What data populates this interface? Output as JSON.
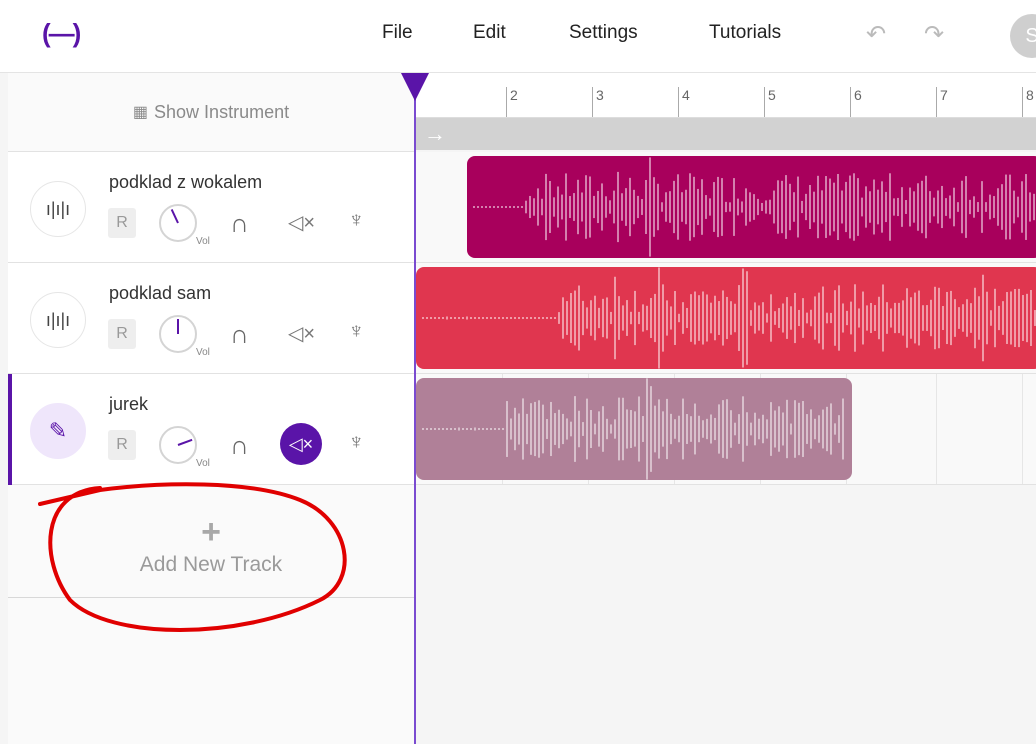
{
  "app": {
    "logo": "(—)"
  },
  "menu": {
    "file": "File",
    "edit": "Edit",
    "settings": "Settings",
    "tutorials": "Tutorials"
  },
  "toolbar": {
    "undo_icon": "undo-icon",
    "redo_icon": "redo-icon",
    "avatar_initial": "S"
  },
  "sidebar": {
    "show_instrument": "Show Instrument",
    "tracks": [
      {
        "name": "podklad z wokalem",
        "icon": "waveform-icon",
        "record": "R",
        "vol_label": "Vol",
        "muted": false,
        "selected": false
      },
      {
        "name": "podklad sam",
        "icon": "waveform-icon",
        "record": "R",
        "vol_label": "Vol",
        "muted": false,
        "selected": false
      },
      {
        "name": "jurek",
        "icon": "microphone-icon",
        "record": "R",
        "vol_label": "Vol",
        "muted": true,
        "selected": true
      }
    ],
    "add_track": "Add New Track"
  },
  "timeline": {
    "ruler_labels": [
      "2",
      "3",
      "4",
      "5",
      "6",
      "7",
      "8"
    ],
    "loop_icon": "→",
    "clip_colors": [
      "#a8005c",
      "#e0364f",
      "#b08098"
    ]
  },
  "colors": {
    "accent": "#5a14a8",
    "annotation": "#e00000"
  }
}
